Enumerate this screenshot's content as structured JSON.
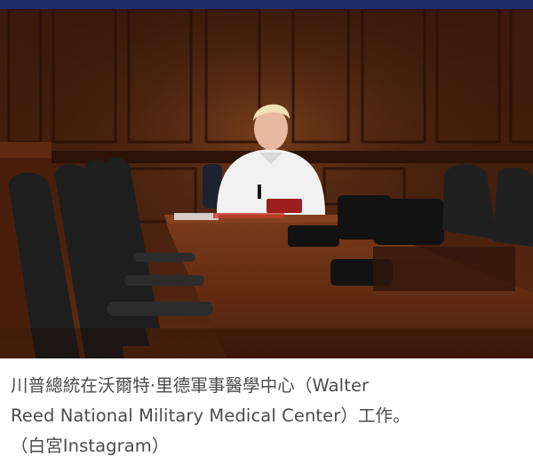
{
  "header": {
    "accent_color": "#1f2f6b"
  },
  "photo": {
    "subject": "man-working-at-conference-table",
    "palette": {
      "wall": "#5a2a14",
      "table": "#6a2e14",
      "chair": "#2b2b2b",
      "shirt": "#f2f2f2"
    }
  },
  "caption": {
    "line1": "川普總統在沃爾特·里德軍事醫學中心（Walter",
    "line2": "Reed National Military Medical Center）工作。",
    "line3": "（白宮Instagram）"
  }
}
